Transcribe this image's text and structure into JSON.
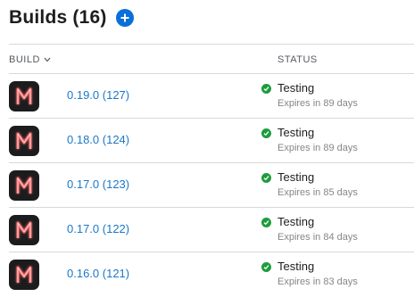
{
  "header": {
    "title": "Builds (16)",
    "add_icon": "plus-circle-icon"
  },
  "table": {
    "columns": {
      "build": "BUILD",
      "status": "STATUS"
    },
    "sort_icon": "chevron-down-icon",
    "rows": [
      {
        "version": "0.19.0 (127)",
        "status": "Testing",
        "expires": "Expires in 89 days",
        "status_icon": "check-circle-icon",
        "app_icon": "app-m-icon"
      },
      {
        "version": "0.18.0 (124)",
        "status": "Testing",
        "expires": "Expires in 89 days",
        "status_icon": "check-circle-icon",
        "app_icon": "app-m-icon"
      },
      {
        "version": "0.17.0 (123)",
        "status": "Testing",
        "expires": "Expires in 85 days",
        "status_icon": "check-circle-icon",
        "app_icon": "app-m-icon"
      },
      {
        "version": "0.17.0 (122)",
        "status": "Testing",
        "expires": "Expires in 84 days",
        "status_icon": "check-circle-icon",
        "app_icon": "app-m-icon"
      },
      {
        "version": "0.16.0 (121)",
        "status": "Testing",
        "expires": "Expires in 83 days",
        "status_icon": "check-circle-icon",
        "app_icon": "app-m-icon"
      }
    ]
  },
  "colors": {
    "accent": "#0a6fd8",
    "link": "#1b78c9",
    "success": "#1e9c3d",
    "app_icon_bg": "#1c1c1e",
    "app_icon_glyph": "#f06a6a"
  }
}
